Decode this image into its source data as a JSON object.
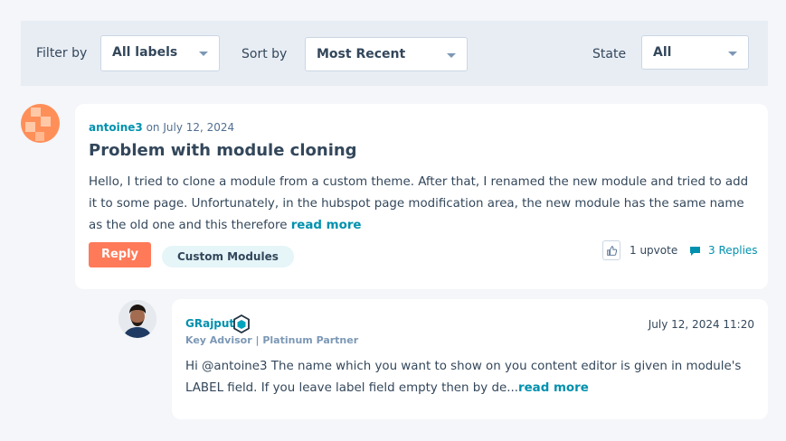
{
  "filters": {
    "filter_by_label": "Filter by",
    "filter_by_value": "All labels",
    "sort_by_label": "Sort by",
    "sort_by_value": "Most Recent",
    "state_label": "State",
    "state_value": "All"
  },
  "post": {
    "author": "antoine3",
    "date_text": "on July 12, 2024",
    "title": "Problem with module cloning",
    "body": "Hello, I tried to clone a module from a custom theme. After that, I renamed the new module and tried to add it to some page. Unfortunately, in the hubspot page modification area, the new module has the same name as the old one and this therefore",
    "read_more": "read more",
    "reply_label": "Reply",
    "tag": "Custom Modules",
    "upvotes": "1 upvote",
    "replies": "3 Replies"
  },
  "reply": {
    "author": "GRajput",
    "role": "Key Advisor | Platinum Partner",
    "date": "July 12, 2024 11:20",
    "body": "Hi @antoine3 The name which you want to show on you content editor is given in module's LABEL field. If you leave label field empty then by de...",
    "read_more": "read more"
  },
  "colors": {
    "accent": "#0091ae",
    "reply_button": "#ff7a59",
    "tag_bg": "#e5f5f8"
  },
  "icons": [
    "thumbs-up-icon",
    "chat-bubble-icon",
    "partner-badge-icon",
    "chevron-down-icon"
  ]
}
